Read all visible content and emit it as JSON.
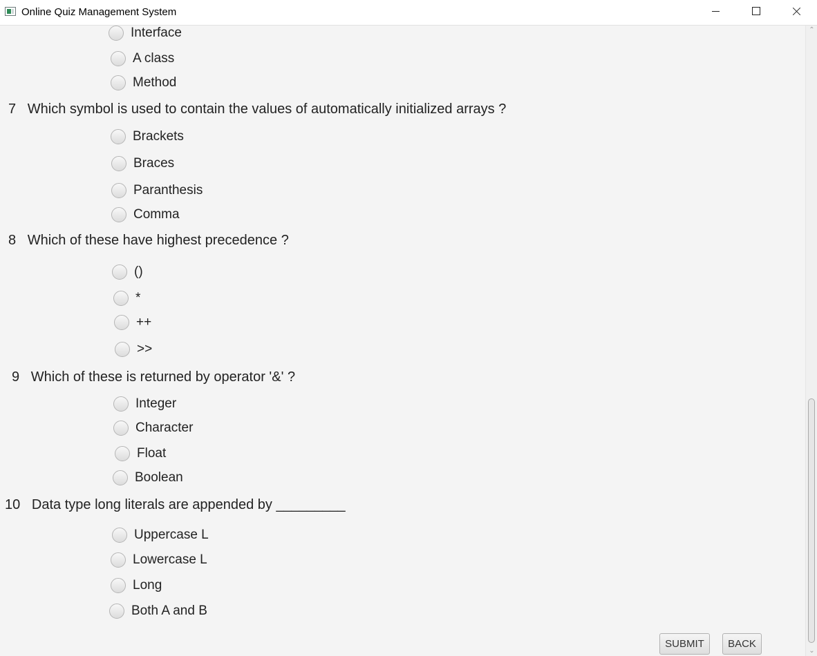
{
  "window": {
    "title": "Online Quiz Management System",
    "icons": {
      "app": "app-icon",
      "minimize": "minimize-icon",
      "maximize": "maximize-icon",
      "close": "close-icon"
    }
  },
  "questions": [
    {
      "number": "",
      "text": "",
      "options": [
        "Interface",
        "A class",
        "Method"
      ]
    },
    {
      "number": "7",
      "text": "Which symbol is used to contain the values of automatically initialized arrays ?",
      "options": [
        "Brackets",
        "Braces",
        "Paranthesis",
        "Comma"
      ]
    },
    {
      "number": "8",
      "text": "Which of these have highest precedence ?",
      "options": [
        "()",
        "*",
        "++",
        ">>"
      ]
    },
    {
      "number": "9",
      "text": "Which of these is returned by operator '&' ?",
      "options": [
        "Integer",
        "Character",
        "Float",
        "Boolean"
      ]
    },
    {
      "number": "10",
      "text": "Data type long literals are appended by _________",
      "options": [
        "Uppercase L",
        "Lowercase L",
        "Long",
        "Both A and B"
      ]
    }
  ],
  "buttons": {
    "submit": "SUBMIT",
    "back": "BACK"
  },
  "scrollbar": {
    "up_icon": "chevron-up-icon",
    "down_icon": "chevron-down-icon",
    "up_glyph": "⌃",
    "down_glyph": "⌄"
  }
}
